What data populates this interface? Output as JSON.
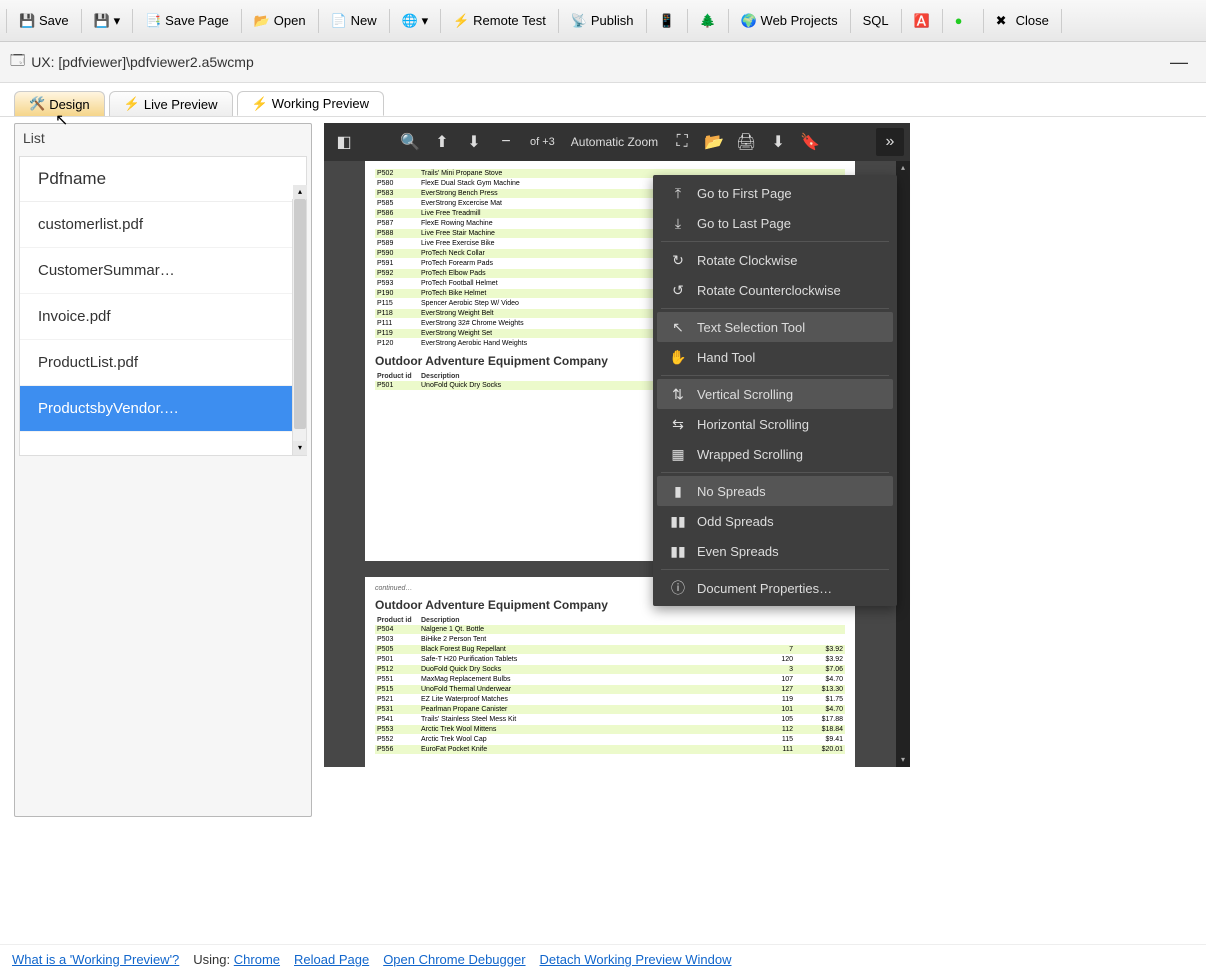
{
  "toolbar": {
    "save": "Save",
    "save_page": "Save Page",
    "open": "Open",
    "new": "New",
    "remote_test": "Remote Test",
    "publish": "Publish",
    "web_projects": "Web Projects",
    "sql": "SQL",
    "close": "Close"
  },
  "window_title": "UX: [pdfviewer]\\pdfviewer2.a5wcmp",
  "tabs": {
    "design": "Design",
    "live_preview": "Live Preview",
    "working_preview": "Working Preview"
  },
  "sidebar": {
    "panel_label": "List",
    "header": "Pdfname",
    "items": [
      "customerlist.pdf",
      "CustomerSummar…",
      "Invoice.pdf",
      "ProductList.pdf",
      "ProductsbyVendor.…"
    ],
    "selected_index": 4
  },
  "pdf_toolbar": {
    "zoom_label": "Automatic Zoom",
    "page_indicator": "of +3"
  },
  "context_menu": {
    "items": [
      {
        "icon": "first-page-icon",
        "label": "Go to First Page",
        "selected": false
      },
      {
        "icon": "last-page-icon",
        "label": "Go to Last Page",
        "selected": false
      }
    ],
    "group2": [
      {
        "icon": "rotate-cw-icon",
        "label": "Rotate Clockwise",
        "selected": false
      },
      {
        "icon": "rotate-ccw-icon",
        "label": "Rotate Counterclockwise",
        "selected": false
      }
    ],
    "group3": [
      {
        "icon": "text-select-icon",
        "label": "Text Selection Tool",
        "selected": true
      },
      {
        "icon": "hand-icon",
        "label": "Hand Tool",
        "selected": false
      }
    ],
    "group4": [
      {
        "icon": "vertical-icon",
        "label": "Vertical Scrolling",
        "selected": true
      },
      {
        "icon": "horizontal-icon",
        "label": "Horizontal Scrolling",
        "selected": false
      },
      {
        "icon": "wrapped-icon",
        "label": "Wrapped Scrolling",
        "selected": false
      }
    ],
    "group5": [
      {
        "icon": "no-spreads-icon",
        "label": "No Spreads",
        "selected": true
      },
      {
        "icon": "odd-spreads-icon",
        "label": "Odd Spreads",
        "selected": false
      },
      {
        "icon": "even-spreads-icon",
        "label": "Even Spreads",
        "selected": false
      }
    ],
    "group6": [
      {
        "icon": "info-icon",
        "label": "Document Properties…",
        "selected": false
      }
    ]
  },
  "pdf_page1": {
    "rows": [
      {
        "id": "P502",
        "desc": "Trails' Mini Propane Stove"
      },
      {
        "id": "P580",
        "desc": "FlexE Dual Stack Gym Machine"
      },
      {
        "id": "P583",
        "desc": "EverStrong Bench Press"
      },
      {
        "id": "P585",
        "desc": "EverStrong Excercise Mat"
      },
      {
        "id": "P586",
        "desc": "Live Free Treadmill"
      },
      {
        "id": "P587",
        "desc": "FlexE Rowing Machine"
      },
      {
        "id": "P588",
        "desc": "Live Free Stair Machine"
      },
      {
        "id": "P589",
        "desc": "Live Free Exercise Bike"
      },
      {
        "id": "P590",
        "desc": "ProTech Neck Collar"
      },
      {
        "id": "P591",
        "desc": "ProTech Forearm Pads"
      },
      {
        "id": "P592",
        "desc": "ProTech Elbow Pads"
      },
      {
        "id": "P593",
        "desc": "ProTech Football Helmet"
      },
      {
        "id": "P190",
        "desc": "ProTech Bike Helmet"
      },
      {
        "id": "P115",
        "desc": "Spencer Aerobic Step W/ Video"
      },
      {
        "id": "P118",
        "desc": "EverStrong Weight Belt"
      },
      {
        "id": "P111",
        "desc": "EverStrong 32# Chrome Weights"
      },
      {
        "id": "P119",
        "desc": "EverStrong Weight Set"
      },
      {
        "id": "P120",
        "desc": "EverStrong Aerobic Hand Weights"
      }
    ],
    "section_title": "Outdoor Adventure Equipment Company",
    "table_headers": {
      "c1": "Product id",
      "c2": "Description"
    },
    "sub_rows": [
      {
        "id": "P501",
        "desc": "UnoFold Quick Dry Socks"
      }
    ]
  },
  "pdf_page2": {
    "continued": "continued…",
    "section_title": "Outdoor Adventure Equipment Company",
    "table_headers": {
      "c1": "Product id",
      "c2": "Description",
      "c3": "",
      "c4": ""
    },
    "rows": [
      {
        "id": "P504",
        "desc": "Nalgene 1 Qt. Bottle",
        "q": "",
        "p": ""
      },
      {
        "id": "P503",
        "desc": "BiHike 2 Person Tent",
        "q": "",
        "p": ""
      },
      {
        "id": "P505",
        "desc": "Black Forest Bug Repellant",
        "q": "7",
        "p": "$3.92"
      },
      {
        "id": "P501",
        "desc": "Safe-T H20 Purification Tablets",
        "q": "120",
        "p": "$3.92"
      },
      {
        "id": "P512",
        "desc": "DuoFold Quick Dry Socks",
        "q": "3",
        "p": "$7.06"
      },
      {
        "id": "P551",
        "desc": "MaxMag Replacement Bulbs",
        "q": "107",
        "p": "$4.70"
      },
      {
        "id": "P515",
        "desc": "UnoFold Thermal Underwear",
        "q": "127",
        "p": "$13.30"
      },
      {
        "id": "P521",
        "desc": "EZ Lite Waterproof Matches",
        "q": "119",
        "p": "$1.75"
      },
      {
        "id": "P531",
        "desc": "Pearlman Propane Canister",
        "q": "101",
        "p": "$4.70"
      },
      {
        "id": "P541",
        "desc": "Trails' Stainless Steel Mess Kit",
        "q": "105",
        "p": "$17.88"
      },
      {
        "id": "P553",
        "desc": "Arctic Trek Wool Mittens",
        "q": "112",
        "p": "$18.84"
      },
      {
        "id": "P552",
        "desc": "Arctic Trek Wool Cap",
        "q": "115",
        "p": "$9.41"
      },
      {
        "id": "P556",
        "desc": "EuroFat Pocket Knife",
        "q": "111",
        "p": "$20.01"
      }
    ]
  },
  "footer": {
    "what_is": "What is a 'Working Preview'?",
    "using_label": "Using:",
    "browser": "Chrome",
    "reload": "Reload Page",
    "open_debugger": "Open Chrome Debugger",
    "detach": "Detach Working Preview Window"
  }
}
